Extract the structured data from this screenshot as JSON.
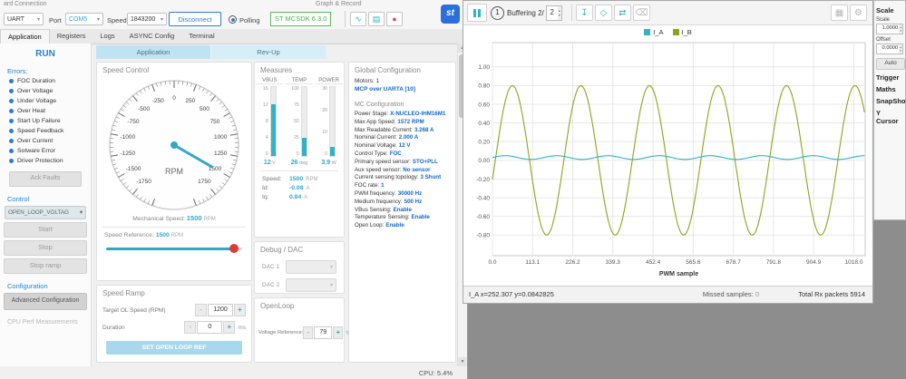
{
  "window": {
    "cpu_label": "CPU: 5.4%"
  },
  "icons": {
    "caret": "▾",
    "minus": "-",
    "plus": "+",
    "record": "●",
    "graph": "∿",
    "table": "▤",
    "download": "↧",
    "marker": "◇",
    "swap": "⇄",
    "erase": "⌫",
    "grid": "▦",
    "gear": "⚙",
    "spin_up": "▴",
    "spin_down": "▾",
    "scroll_up": "▲",
    "scroll_down": "▼",
    "logo": "st"
  },
  "toolbar": {
    "group1_label": "ard Connection",
    "group2_label": "Graph & Record",
    "uart": "UART",
    "port_label": "Port",
    "port": "COM5",
    "speed_label": "Speed",
    "baud": "1843200",
    "disconnect": "Disconnect",
    "polling": "Polling",
    "sdk": "ST MCSDK 6.3.0"
  },
  "tabs": {
    "items": [
      "Application",
      "Registers",
      "Logs",
      "ASYNC Config",
      "Terminal"
    ],
    "active": "Application"
  },
  "sidebar": {
    "state": "RUN",
    "errors_label": "Errors:",
    "errors": [
      "FOC Duration",
      "Over Voltage",
      "Under Voltage",
      "Over Heat",
      "Start Up Failure",
      "Speed Feedback",
      "Over Current",
      "Sotware Error",
      "Driver Protection"
    ],
    "ack": "Ack Faults",
    "control_label": "Control",
    "control_mode": "OPEN_LOOP_VOLTAG",
    "buttons": [
      "Start",
      "Stop",
      "Stop ramp"
    ],
    "config_label": "Configuration",
    "adv_config": "Advanced Configuration",
    "cpu_perf": "CPU Perf Measurements"
  },
  "content_tabs": {
    "tab1": "Application",
    "tab2": "Rev-Up"
  },
  "speed_control": {
    "title": "Speed Control",
    "gauge": {
      "min": -2000,
      "max": 2000,
      "step": 250,
      "minor_step": 50,
      "value": 1500,
      "unit": "RPM",
      "sweep_deg": 320
    },
    "mech_label": "Mechanical Speed:",
    "mech_value": "1500",
    "mech_unit": "RPM",
    "ref_label": "Speed Reference:",
    "ref_value": "1500",
    "ref_unit": "RPM"
  },
  "speed_ramp": {
    "title": "Speed Ramp",
    "target_label": "Target OL Speed (RPM)",
    "target_value": "1200",
    "duration_label": "Duration",
    "duration_value": "0",
    "duration_unit": "ms",
    "set_button": "SET OPEN LOOP REF"
  },
  "measures": {
    "title": "Measures",
    "gauges": [
      {
        "name": "VBUS",
        "ticks": [
          "16",
          "12",
          "8",
          "4",
          "0"
        ],
        "value": "12",
        "unit": "V",
        "fill": 0.75
      },
      {
        "name": "TEMP",
        "ticks": [
          "100",
          "75",
          "50",
          "25",
          "0"
        ],
        "value": "26",
        "unit": "deg",
        "fill": 0.26
      },
      {
        "name": "POWER",
        "ticks": [
          "30",
          "20",
          "10",
          "0"
        ],
        "value": "3.9",
        "unit": "W",
        "fill": 0.13
      }
    ],
    "speed_label": "Speed:",
    "speed_value": "1500",
    "speed_unit": "RPM",
    "id_label": "Id:",
    "id_value": "-0.08",
    "id_unit": "A",
    "iq_label": "Iq:",
    "iq_value": "0.84",
    "iq_unit": "A"
  },
  "debug_dac": {
    "title": "Debug / DAC",
    "dac1": "DAC 1",
    "dac2": "DAC 2"
  },
  "openloop": {
    "title": "OpenLoop",
    "label": "Voltage Reference:",
    "value": "79",
    "unit": "%"
  },
  "global_config": {
    "title": "Global Configuration",
    "motors": "Motors: 1",
    "mcp": "MCP over UARTA [10]",
    "subtitle": "MC Configuration",
    "items": [
      {
        "label": "Power Stage:",
        "value": "X-NUCLEO-IHM16M1"
      },
      {
        "label": "Max App Speed:",
        "value": "1572 RPM"
      },
      {
        "label": "Max Readable Current:",
        "value": "3.268 A"
      },
      {
        "label": "Nominal Current:",
        "value": "2.000 A"
      },
      {
        "label": "Nominal Voltage:",
        "value": "12 V"
      },
      {
        "label": "Control Type:",
        "value": "FOC"
      },
      {
        "label": "Primary speed sensor:",
        "value": "STO+PLL"
      },
      {
        "label": "Aux speed sensor:",
        "value": "No sensor"
      },
      {
        "label": "Current sensing topology:",
        "value": "3 Shunt"
      },
      {
        "label": "FOC rate:",
        "value": "1"
      },
      {
        "label": "PWM frequency:",
        "value": "30000 Hz"
      },
      {
        "label": "Medium frequency:",
        "value": "500 Hz"
      },
      {
        "label": "VBus Sensing:",
        "value": "Enable"
      },
      {
        "label": "Temperature Sensing:",
        "value": "Enable"
      },
      {
        "label": "Open Loop:",
        "value": "Enable"
      }
    ]
  },
  "scope": {
    "badge": "1",
    "buffering_label": "Buffering 2/",
    "buffer_count": "2",
    "status_cursor": "I_A x=252.307 y=0.0842825",
    "missed_label": "Missed samples:",
    "missed_value": "0",
    "rx_label": "Total Rx packets",
    "rx_value": "5914",
    "side": {
      "scale_header": "Scale",
      "scale_label": "Scale",
      "scale_value": "1.0000",
      "offset_label": "Offset",
      "offset_value": "0.0000",
      "auto": "Auto",
      "trigger": "Trigger",
      "maths": "Maths",
      "snapshot": "SnapShot",
      "ycursor": "Y Cursor"
    }
  },
  "chart_data": {
    "type": "line",
    "title": "",
    "xlabel": "PWM sample",
    "ylabel": "",
    "xlim": [
      0,
      1050
    ],
    "ylim": [
      -1.02,
      1.26
    ],
    "x_ticks": [
      0.0,
      113.1,
      226.2,
      339.3,
      452.4,
      565.6,
      678.7,
      791.8,
      904.9,
      1018.0
    ],
    "y_ticks": [
      1.0,
      0.8,
      0.6,
      0.4,
      0.2,
      0.0,
      -0.2,
      -0.4,
      -0.6,
      -0.8
    ],
    "grid": true,
    "legend_position": "top",
    "legend": [
      {
        "name": "I_A",
        "color": "#2fb4c7"
      },
      {
        "name": "I_B",
        "color": "#8aa61c"
      }
    ],
    "series": [
      {
        "name": "I_A",
        "color": "#2fb4c7",
        "type": "flat",
        "mean": 0.03,
        "ripple": 0.02
      },
      {
        "name": "I_B",
        "color": "#8aa61c",
        "type": "sine",
        "amplitude": 0.8,
        "period": 193,
        "phase": 8
      }
    ]
  }
}
